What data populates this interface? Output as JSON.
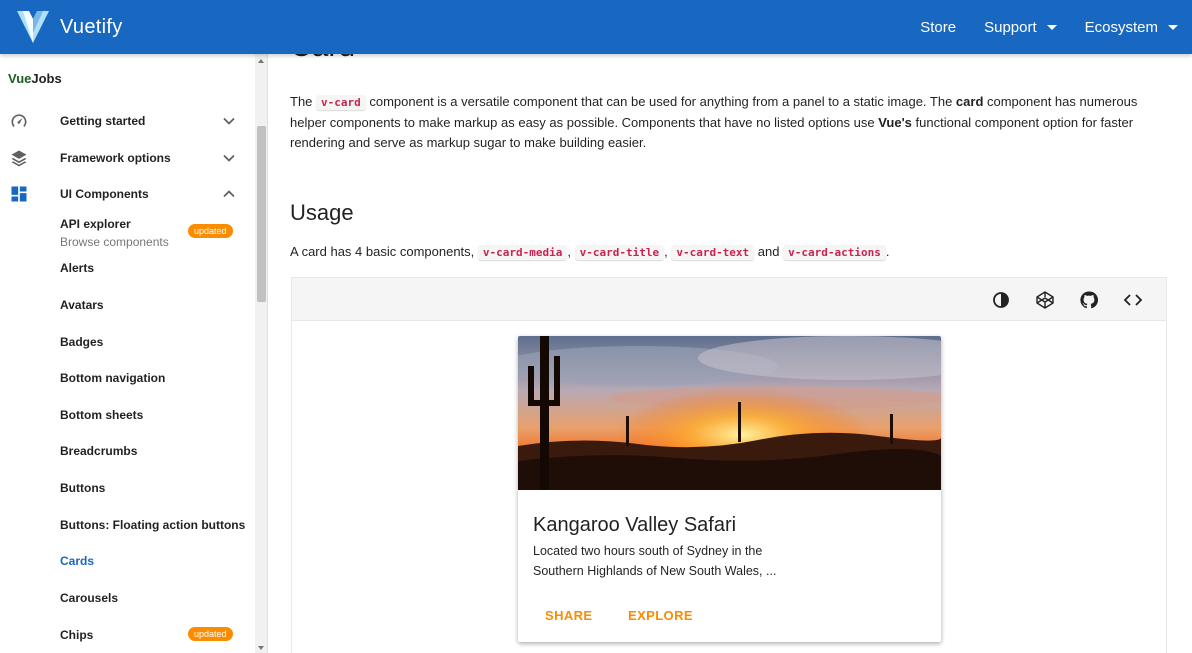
{
  "appbar": {
    "brand": "Vuetify",
    "links": [
      {
        "label": "Store",
        "has_menu": false
      },
      {
        "label": "Support",
        "has_menu": true
      },
      {
        "label": "Ecosystem",
        "has_menu": true
      }
    ],
    "color": "#1867c0"
  },
  "sidebar": {
    "sponsor": {
      "part1": "Vue",
      "part2": "Jobs"
    },
    "groups": [
      {
        "label": "Getting started",
        "icon": "speedometer-icon",
        "expanded": false
      },
      {
        "label": "Framework options",
        "icon": "layers-icon",
        "expanded": false
      },
      {
        "label": "UI Components",
        "icon": "view-dashboard-icon",
        "expanded": true
      }
    ],
    "items": [
      {
        "label": "API explorer",
        "subtext": "Browse components",
        "badge": "updated"
      },
      {
        "label": "Alerts"
      },
      {
        "label": "Avatars"
      },
      {
        "label": "Badges"
      },
      {
        "label": "Bottom navigation"
      },
      {
        "label": "Bottom sheets"
      },
      {
        "label": "Breadcrumbs"
      },
      {
        "label": "Buttons"
      },
      {
        "label": "Buttons: Floating action buttons"
      },
      {
        "label": "Cards",
        "active": true
      },
      {
        "label": "Carousels"
      },
      {
        "label": "Chips",
        "badge": "updated"
      }
    ],
    "active_color": "#1867c0",
    "badge_color": "#fb8c00"
  },
  "main": {
    "title": "Card",
    "intro": {
      "t1": "The ",
      "code": "v-card",
      "t2": " component is a versatile component that can be used for anything from a panel to a static image. The ",
      "b1": "card",
      "t3": " component has numerous helper components to make markup as easy as possible. Components that have no listed options use ",
      "b2": "Vue's",
      "t4": " functional component option for faster rendering and serve as markup sugar to make building easier."
    },
    "usage": {
      "title": "Usage",
      "t1": "A card has 4 basic components, ",
      "c1": "v-card-media",
      "sep1": ", ",
      "c2": "v-card-title",
      "sep2": ", ",
      "c3": "v-card-text",
      "t2": " and ",
      "c4": "v-card-actions",
      "t3": "."
    },
    "example_toolbar": [
      "invert-colors-icon",
      "codepen-icon",
      "github-icon",
      "code-icon"
    ],
    "card": {
      "title": "Kangaroo Valley Safari",
      "text": "Located two hours south of Sydney in the Southern Highlands of New South Wales, ...",
      "actions": [
        "SHARE",
        "EXPLORE"
      ],
      "action_color": "#fb8c00"
    }
  }
}
